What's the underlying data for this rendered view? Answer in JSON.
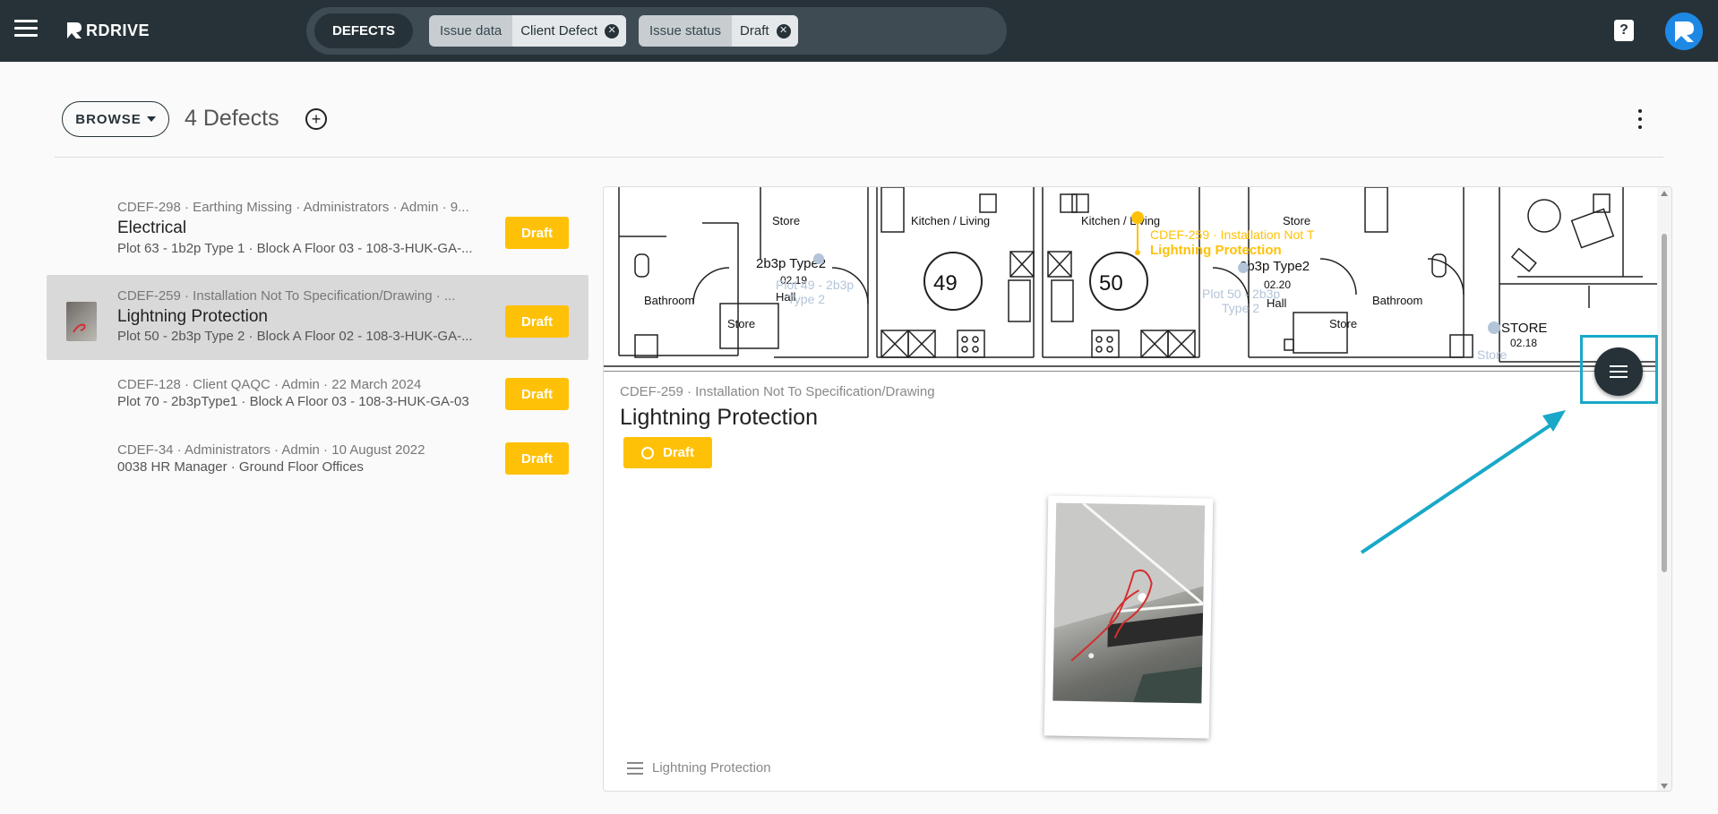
{
  "app": {
    "brand": "RDRIVE"
  },
  "topbar": {
    "module_label": "DEFECTS",
    "filters": [
      {
        "key": "Issue data",
        "value": "Client Defect"
      },
      {
        "key": "Issue status",
        "value": "Draft"
      }
    ],
    "help_label": "?"
  },
  "header": {
    "browse_label": "BROWSE",
    "count_title": "4 Defects",
    "add_label": "+"
  },
  "defects": [
    {
      "meta": "CDEF-298 · Earthing Missing · Administrators · Admin · 9...",
      "title": "Electrical",
      "sub": "Plot 63 - 1b2p Type 1 · Block A Floor 03 - 108-3-HUK-GA-...",
      "status": "Draft"
    },
    {
      "meta": "CDEF-259 · Installation Not To Specification/Drawing · ...",
      "title": "Lightning Protection",
      "sub": "Plot 50 - 2b3p Type 2 · Block A Floor 02 - 108-3-HUK-GA-...",
      "status": "Draft"
    },
    {
      "meta": "CDEF-128 · Client QAQC · Admin · 22 March 2024",
      "sub": "Plot 70 - 2b3pType1 · Block A Floor 03 - 108-3-HUK-GA-03",
      "status": "Draft"
    },
    {
      "meta": "CDEF-34 · Administrators · Admin · 10 August 2022",
      "sub": "0038 HR Manager · Ground Floor Offices",
      "status": "Draft"
    }
  ],
  "plan": {
    "rooms": {
      "store": "Store",
      "kitchen": "Kitchen / Living",
      "bathroom": "Bathroom",
      "hall": "Hall",
      "type_left": "2b3p Type2",
      "num_left": "02.19",
      "type_right": "2b3p Type2",
      "num_right": "02.20",
      "store_big": "STORE",
      "store_big_num": "02.18",
      "plot_left_ghost": "Plot 49 - 2b3p",
      "plot_left_ghost2": "Type 2",
      "plot_right_ghost": "Plot 50 - 2b3p",
      "plot_right_ghost2": "Type 2",
      "store_ghost": "Store",
      "unit_49": "49",
      "unit_50": "50",
      "pin_line1": "CDEF-259 · Installation Not T",
      "pin_line2": "Lightning Protection"
    }
  },
  "detail": {
    "meta": "CDEF-259 · Installation Not To Specification/Drawing",
    "title": "Lightning Protection",
    "status": "Draft",
    "footer_label": "Lightning Protection"
  },
  "colors": {
    "topbar": "#263238",
    "accent": "#ffc107",
    "highlight": "#19a8c8"
  }
}
